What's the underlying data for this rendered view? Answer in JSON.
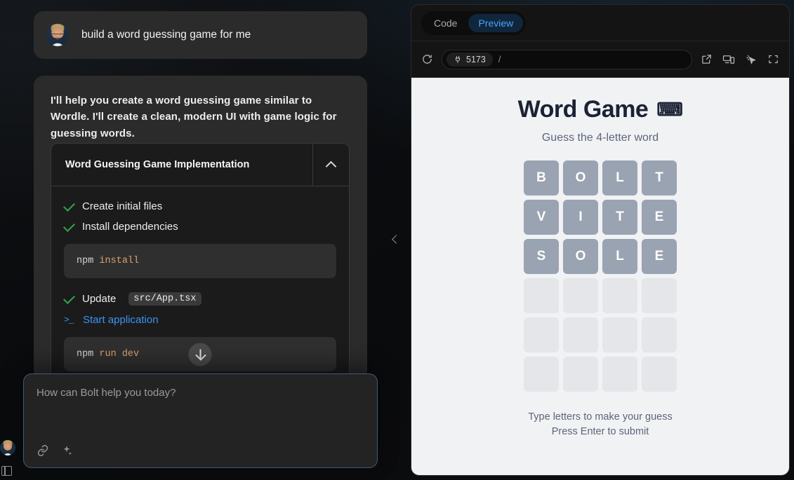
{
  "chat": {
    "user_message": {
      "avatar": "user-avatar",
      "text": "build a word guessing game for me"
    },
    "assistant_message": {
      "text": "I'll help you create a word guessing game similar to Wordle. I'll create a clean, modern UI with game logic for guessing words."
    },
    "artifact": {
      "title": "Word Guessing Game Implementation",
      "toggle_icon": "chevron-up-icon",
      "tasks": [
        {
          "icon": "check-icon",
          "label": "Create initial files",
          "state": "done"
        },
        {
          "icon": "check-icon",
          "label": "Install dependencies",
          "state": "done"
        },
        {
          "icon": "check-icon",
          "label": "Update",
          "file": "src/App.tsx",
          "state": "done"
        },
        {
          "icon": "terminal-icon",
          "label": "Start application",
          "state": "running"
        }
      ],
      "code_blocks": [
        {
          "cmd": "npm",
          "arg": "install"
        },
        {
          "cmd": "npm",
          "arg": "run dev"
        }
      ],
      "scroll_button_icon": "arrow-down-icon"
    }
  },
  "composer": {
    "placeholder": "How can Bolt help you today?",
    "attach_icon": "link-icon",
    "enhance_icon": "sparkles-icon"
  },
  "rail": {
    "avatar": "user-avatar",
    "toggle_sidebar_icon": "panel-toggle-icon"
  },
  "collapse_handle_icon": "chevron-left-icon",
  "preview": {
    "tabs": [
      {
        "label": "Code",
        "active": false
      },
      {
        "label": "Preview",
        "active": true
      }
    ],
    "reload_icon": "refresh-icon",
    "port": "5173",
    "port_icon": "plug-icon",
    "path": "/",
    "actions": [
      {
        "icon": "external-link-icon"
      },
      {
        "icon": "device-preview-icon"
      },
      {
        "icon": "inspector-cursor-icon"
      },
      {
        "icon": "fullscreen-icon"
      }
    ]
  },
  "game": {
    "title": "Word Game",
    "title_emoji": "⌨",
    "subtitle": "Guess the 4-letter word",
    "rows": [
      [
        "B",
        "O",
        "L",
        "T"
      ],
      [
        "V",
        "I",
        "T",
        "E"
      ],
      [
        "S",
        "O",
        "L",
        "E"
      ],
      [
        "",
        "",
        "",
        ""
      ],
      [
        "",
        "",
        "",
        ""
      ],
      [
        "",
        "",
        "",
        ""
      ]
    ],
    "hint_line1": "Type letters to make your guess",
    "hint_line2": "Press Enter to submit"
  },
  "colors": {
    "accent_blue": "#4aa3ff",
    "check_green": "#2fa84f",
    "tile_filled": "#9aa3b2",
    "tile_empty": "#e4e6ea",
    "preview_bg": "#f1f2f4"
  }
}
